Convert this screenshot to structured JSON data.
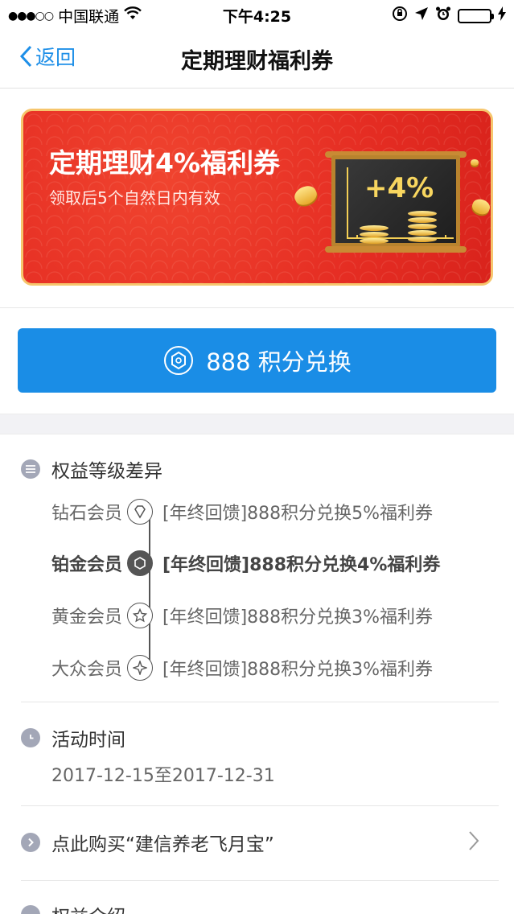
{
  "status_bar": {
    "signal_dots": "●●●○○",
    "carrier": "中国联通",
    "wifi_icon": "wifi-icon",
    "time": "下午4:25",
    "battery_color": "#4cd964"
  },
  "nav": {
    "back_label": "返回",
    "title": "定期理财福利券"
  },
  "banner": {
    "title": "定期理财4%福利券",
    "subtitle": "领取后5个自然日内有效",
    "board_text": "+4%"
  },
  "exchange_button": {
    "label": "888 积分兑换",
    "color": "#1a8de6"
  },
  "tiers_section": {
    "heading": "权益等级差异",
    "tiers": [
      {
        "name": "钻石会员",
        "text": "[年终回馈]888积分兑换5%福利券",
        "icon": "diamond-icon",
        "active": false
      },
      {
        "name": "铂金会员",
        "text": "[年终回馈]888积分兑换4%福利券",
        "icon": "platinum-icon",
        "active": true
      },
      {
        "name": "黄金会员",
        "text": "[年终回馈]888积分兑换3%福利券",
        "icon": "star-icon",
        "active": false
      },
      {
        "name": "大众会员",
        "text": "[年终回馈]888积分兑换3%福利券",
        "icon": "sparkle-icon",
        "active": false
      }
    ]
  },
  "activity_section": {
    "heading": "活动时间",
    "dates": "2017-12-15至2017-12-31"
  },
  "purchase_link": {
    "label": "点此购买“建信养老飞月宝”"
  },
  "intro_section": {
    "heading": "权益介绍"
  }
}
